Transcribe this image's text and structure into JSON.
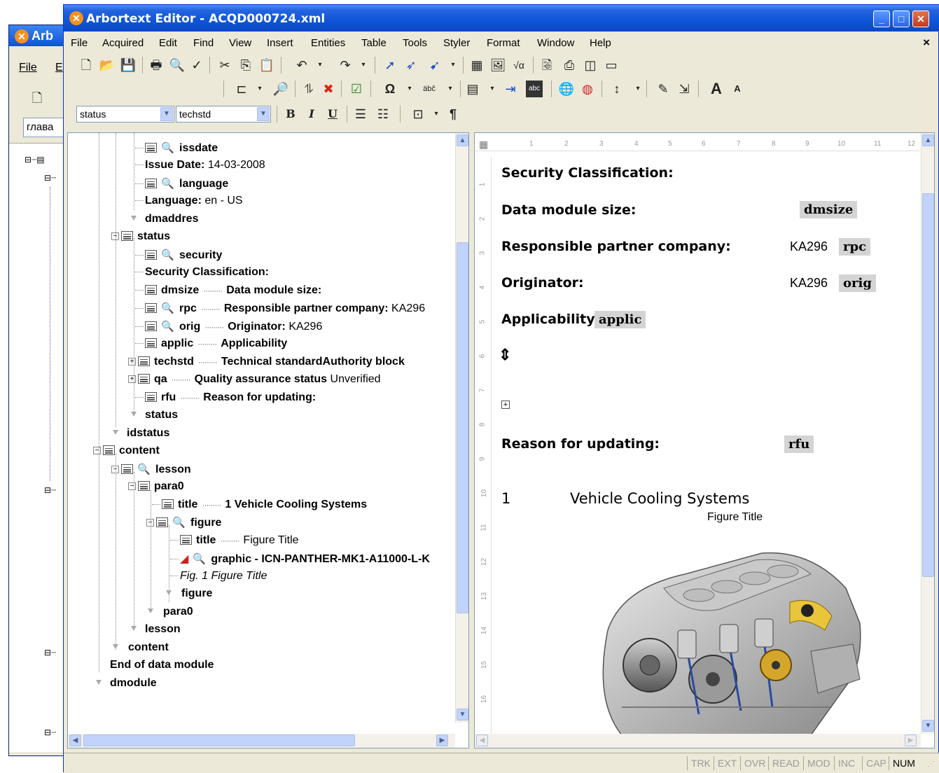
{
  "bg_window": {
    "title": "Arb",
    "menu": [
      "File",
      "E"
    ],
    "combo": "глава"
  },
  "window": {
    "title": "Arbortext Editor - ACQD000724.xml",
    "controls": {
      "minimize": "_",
      "maximize": "□",
      "close": "✕"
    }
  },
  "menubar": {
    "items": [
      "File",
      "Acquired",
      "Edit",
      "Find",
      "View",
      "Insert",
      "Entities",
      "Table",
      "Tools",
      "Styler",
      "Format",
      "Window",
      "Help"
    ],
    "close": "×"
  },
  "toolbar": {
    "element_combo": "status",
    "context_combo": "techstd",
    "bold": "B",
    "italic": "I",
    "underline": "U",
    "pilcrow": "¶"
  },
  "tree": {
    "rows": [
      {
        "tag": "issdate",
        "label": "",
        "value": ""
      },
      {
        "tag": "",
        "label": "Issue Date:",
        "value": "14-03-2008"
      },
      {
        "tag": "language",
        "label": "",
        "value": ""
      },
      {
        "tag": "",
        "label": "Language:",
        "value": "en - US"
      },
      {
        "tag": "dmaddres",
        "label": "",
        "value": ""
      },
      {
        "tag": "status",
        "label": "",
        "value": ""
      },
      {
        "tag": "security",
        "label": "",
        "value": ""
      },
      {
        "tag": "",
        "label": "Security Classification:",
        "value": ""
      },
      {
        "tag": "dmsize",
        "label": "Data module size:",
        "value": ""
      },
      {
        "tag": "rpc",
        "label": "Responsible partner company:",
        "value": "KA296"
      },
      {
        "tag": "orig",
        "label": "Originator:",
        "value": "KA296"
      },
      {
        "tag": "applic",
        "label": "Applicability",
        "value": ""
      },
      {
        "tag": "techstd",
        "label": "Technical standardAuthority block",
        "value": ""
      },
      {
        "tag": "qa",
        "label": "Quality assurance status",
        "value": "Unverified"
      },
      {
        "tag": "rfu",
        "label": "Reason for updating:",
        "value": ""
      },
      {
        "tag": "status",
        "label": "",
        "value": ""
      },
      {
        "tag": "idstatus",
        "label": "",
        "value": ""
      },
      {
        "tag": "content",
        "label": "",
        "value": ""
      },
      {
        "tag": "lesson",
        "label": "",
        "value": ""
      },
      {
        "tag": "para0",
        "label": "",
        "value": ""
      },
      {
        "tag": "title",
        "label": "1 Vehicle Cooling Systems",
        "value": ""
      },
      {
        "tag": "figure",
        "label": "",
        "value": ""
      },
      {
        "tag": "title",
        "label": "",
        "value": "Figure Title"
      },
      {
        "tag": "graphic - ICN-PANTHER-MK1-A11000-L-K",
        "label": "",
        "value": ""
      },
      {
        "tag": "",
        "label": "",
        "value": "Fig. 1 Figure Title"
      },
      {
        "tag": "figure",
        "label": "",
        "value": ""
      },
      {
        "tag": "para0",
        "label": "",
        "value": ""
      },
      {
        "tag": "lesson",
        "label": "",
        "value": ""
      },
      {
        "tag": "content",
        "label": "",
        "value": ""
      },
      {
        "tag": "",
        "label": "End of data module",
        "value": ""
      },
      {
        "tag": "dmodule",
        "label": "",
        "value": ""
      }
    ]
  },
  "document": {
    "ruler_marks": [
      "1",
      "2",
      "3",
      "4",
      "5",
      "6",
      "7",
      "8",
      "9",
      "10",
      "11",
      "12"
    ],
    "vruler_marks": [
      "1",
      "2",
      "3",
      "4",
      "5",
      "6",
      "7",
      "8",
      "9",
      "10",
      "11",
      "12",
      "13",
      "14",
      "15",
      "16"
    ],
    "security_label": "Security Classification:",
    "dmsize_label": "Data module size:",
    "dmsize_tag": "dmsize",
    "rpc_label": "Responsible partner company:",
    "rpc_value": "KA296",
    "rpc_tag": "rpc",
    "orig_label": "Originator:",
    "orig_value": "KA296",
    "orig_tag": "orig",
    "applic_label": "Applicability",
    "applic_tag": "applic",
    "rfu_label": "Reason for updating:",
    "rfu_tag": "rfu",
    "section_number": "1",
    "section_title": "Vehicle Cooling Systems",
    "figure_title": "Figure Title"
  },
  "statusbar": {
    "indicators": [
      {
        "label": "TRK",
        "active": false
      },
      {
        "label": "EXT",
        "active": false
      },
      {
        "label": "OVR",
        "active": false
      },
      {
        "label": "READ",
        "active": false
      },
      {
        "label": "MOD",
        "active": false
      },
      {
        "label": "INC",
        "active": false
      },
      {
        "label": "CAP",
        "active": false
      },
      {
        "label": "NUM",
        "active": true
      }
    ]
  },
  "colors": {
    "titlebar": "#0d55d8",
    "chrome": "#ece9d8",
    "tag_bg": "#d4d4d4",
    "scroll": "#c1d3fb"
  }
}
